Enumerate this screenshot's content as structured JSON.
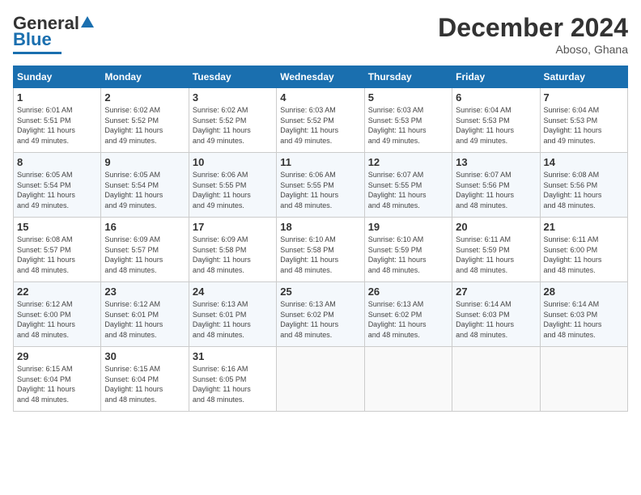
{
  "header": {
    "logo_text_general": "General",
    "logo_text_blue": "Blue",
    "month_year": "December 2024",
    "location": "Aboso, Ghana"
  },
  "days_of_week": [
    "Sunday",
    "Monday",
    "Tuesday",
    "Wednesday",
    "Thursday",
    "Friday",
    "Saturday"
  ],
  "weeks": [
    [
      {
        "day": "1",
        "detail": "Sunrise: 6:01 AM\nSunset: 5:51 PM\nDaylight: 11 hours\nand 49 minutes."
      },
      {
        "day": "2",
        "detail": "Sunrise: 6:02 AM\nSunset: 5:52 PM\nDaylight: 11 hours\nand 49 minutes."
      },
      {
        "day": "3",
        "detail": "Sunrise: 6:02 AM\nSunset: 5:52 PM\nDaylight: 11 hours\nand 49 minutes."
      },
      {
        "day": "4",
        "detail": "Sunrise: 6:03 AM\nSunset: 5:52 PM\nDaylight: 11 hours\nand 49 minutes."
      },
      {
        "day": "5",
        "detail": "Sunrise: 6:03 AM\nSunset: 5:53 PM\nDaylight: 11 hours\nand 49 minutes."
      },
      {
        "day": "6",
        "detail": "Sunrise: 6:04 AM\nSunset: 5:53 PM\nDaylight: 11 hours\nand 49 minutes."
      },
      {
        "day": "7",
        "detail": "Sunrise: 6:04 AM\nSunset: 5:53 PM\nDaylight: 11 hours\nand 49 minutes."
      }
    ],
    [
      {
        "day": "8",
        "detail": "Sunrise: 6:05 AM\nSunset: 5:54 PM\nDaylight: 11 hours\nand 49 minutes."
      },
      {
        "day": "9",
        "detail": "Sunrise: 6:05 AM\nSunset: 5:54 PM\nDaylight: 11 hours\nand 49 minutes."
      },
      {
        "day": "10",
        "detail": "Sunrise: 6:06 AM\nSunset: 5:55 PM\nDaylight: 11 hours\nand 49 minutes."
      },
      {
        "day": "11",
        "detail": "Sunrise: 6:06 AM\nSunset: 5:55 PM\nDaylight: 11 hours\nand 48 minutes."
      },
      {
        "day": "12",
        "detail": "Sunrise: 6:07 AM\nSunset: 5:55 PM\nDaylight: 11 hours\nand 48 minutes."
      },
      {
        "day": "13",
        "detail": "Sunrise: 6:07 AM\nSunset: 5:56 PM\nDaylight: 11 hours\nand 48 minutes."
      },
      {
        "day": "14",
        "detail": "Sunrise: 6:08 AM\nSunset: 5:56 PM\nDaylight: 11 hours\nand 48 minutes."
      }
    ],
    [
      {
        "day": "15",
        "detail": "Sunrise: 6:08 AM\nSunset: 5:57 PM\nDaylight: 11 hours\nand 48 minutes."
      },
      {
        "day": "16",
        "detail": "Sunrise: 6:09 AM\nSunset: 5:57 PM\nDaylight: 11 hours\nand 48 minutes."
      },
      {
        "day": "17",
        "detail": "Sunrise: 6:09 AM\nSunset: 5:58 PM\nDaylight: 11 hours\nand 48 minutes."
      },
      {
        "day": "18",
        "detail": "Sunrise: 6:10 AM\nSunset: 5:58 PM\nDaylight: 11 hours\nand 48 minutes."
      },
      {
        "day": "19",
        "detail": "Sunrise: 6:10 AM\nSunset: 5:59 PM\nDaylight: 11 hours\nand 48 minutes."
      },
      {
        "day": "20",
        "detail": "Sunrise: 6:11 AM\nSunset: 5:59 PM\nDaylight: 11 hours\nand 48 minutes."
      },
      {
        "day": "21",
        "detail": "Sunrise: 6:11 AM\nSunset: 6:00 PM\nDaylight: 11 hours\nand 48 minutes."
      }
    ],
    [
      {
        "day": "22",
        "detail": "Sunrise: 6:12 AM\nSunset: 6:00 PM\nDaylight: 11 hours\nand 48 minutes."
      },
      {
        "day": "23",
        "detail": "Sunrise: 6:12 AM\nSunset: 6:01 PM\nDaylight: 11 hours\nand 48 minutes."
      },
      {
        "day": "24",
        "detail": "Sunrise: 6:13 AM\nSunset: 6:01 PM\nDaylight: 11 hours\nand 48 minutes."
      },
      {
        "day": "25",
        "detail": "Sunrise: 6:13 AM\nSunset: 6:02 PM\nDaylight: 11 hours\nand 48 minutes."
      },
      {
        "day": "26",
        "detail": "Sunrise: 6:13 AM\nSunset: 6:02 PM\nDaylight: 11 hours\nand 48 minutes."
      },
      {
        "day": "27",
        "detail": "Sunrise: 6:14 AM\nSunset: 6:03 PM\nDaylight: 11 hours\nand 48 minutes."
      },
      {
        "day": "28",
        "detail": "Sunrise: 6:14 AM\nSunset: 6:03 PM\nDaylight: 11 hours\nand 48 minutes."
      }
    ],
    [
      {
        "day": "29",
        "detail": "Sunrise: 6:15 AM\nSunset: 6:04 PM\nDaylight: 11 hours\nand 48 minutes."
      },
      {
        "day": "30",
        "detail": "Sunrise: 6:15 AM\nSunset: 6:04 PM\nDaylight: 11 hours\nand 48 minutes."
      },
      {
        "day": "31",
        "detail": "Sunrise: 6:16 AM\nSunset: 6:05 PM\nDaylight: 11 hours\nand 48 minutes."
      },
      {
        "day": "",
        "detail": ""
      },
      {
        "day": "",
        "detail": ""
      },
      {
        "day": "",
        "detail": ""
      },
      {
        "day": "",
        "detail": ""
      }
    ]
  ]
}
